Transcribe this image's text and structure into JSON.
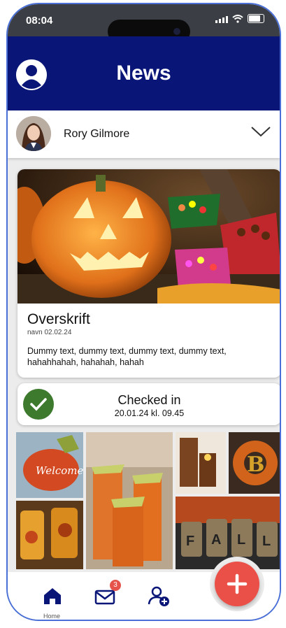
{
  "status_bar": {
    "time": "08:04"
  },
  "header": {
    "title": "News"
  },
  "profile": {
    "name": "Rory Gilmore"
  },
  "post": {
    "headline": "Overskrift",
    "meta": "navn 02.02.24",
    "body": "Dummy text, dummy text, dummy text, dummy text, hahahhahah, hahahah, hahah"
  },
  "checkin": {
    "title": "Checked in",
    "when": "20.01.24 kl. 09.45"
  },
  "gallery": {
    "sign_text": "Welcome",
    "letter": "B",
    "jar_letters": [
      "F",
      "A",
      "L",
      "L"
    ]
  },
  "tabbar": {
    "home_label": "Home",
    "messages_badge": "3"
  },
  "colors": {
    "header_bg": "#0a1677",
    "accent_red": "#ea5048",
    "check_green": "#3e7a2e",
    "tab_icon": "#0a1677"
  },
  "icons": [
    "user-circle-icon",
    "chevron-down-icon",
    "check-icon",
    "home-icon",
    "mail-icon",
    "add-user-icon",
    "plus-icon"
  ]
}
